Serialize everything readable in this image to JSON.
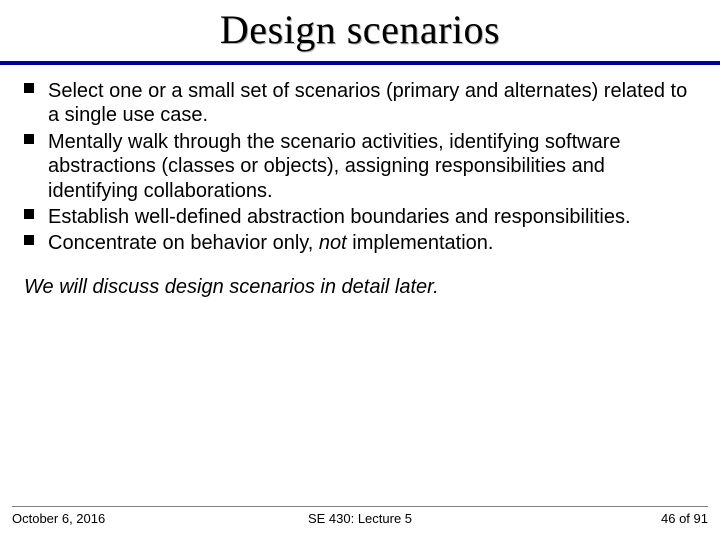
{
  "title": "Design scenarios",
  "bullets": [
    "Select one or a small set of scenarios (primary and alternates) related to a single use case.",
    "Mentally walk through the scenario activities, identifying software abstractions (classes or objects), assigning responsibilities and identifying collaborations.",
    "Establish well-defined abstraction boundaries and responsibilities."
  ],
  "bullet4_pre": "Concentrate on behavior only, ",
  "bullet4_em": "not",
  "bullet4_post": " implementation.",
  "closing": "We will discuss design scenarios in detail later.",
  "footer": {
    "date": "October 6, 2016",
    "course": "SE 430: Lecture 5",
    "page": "46 of 91"
  }
}
